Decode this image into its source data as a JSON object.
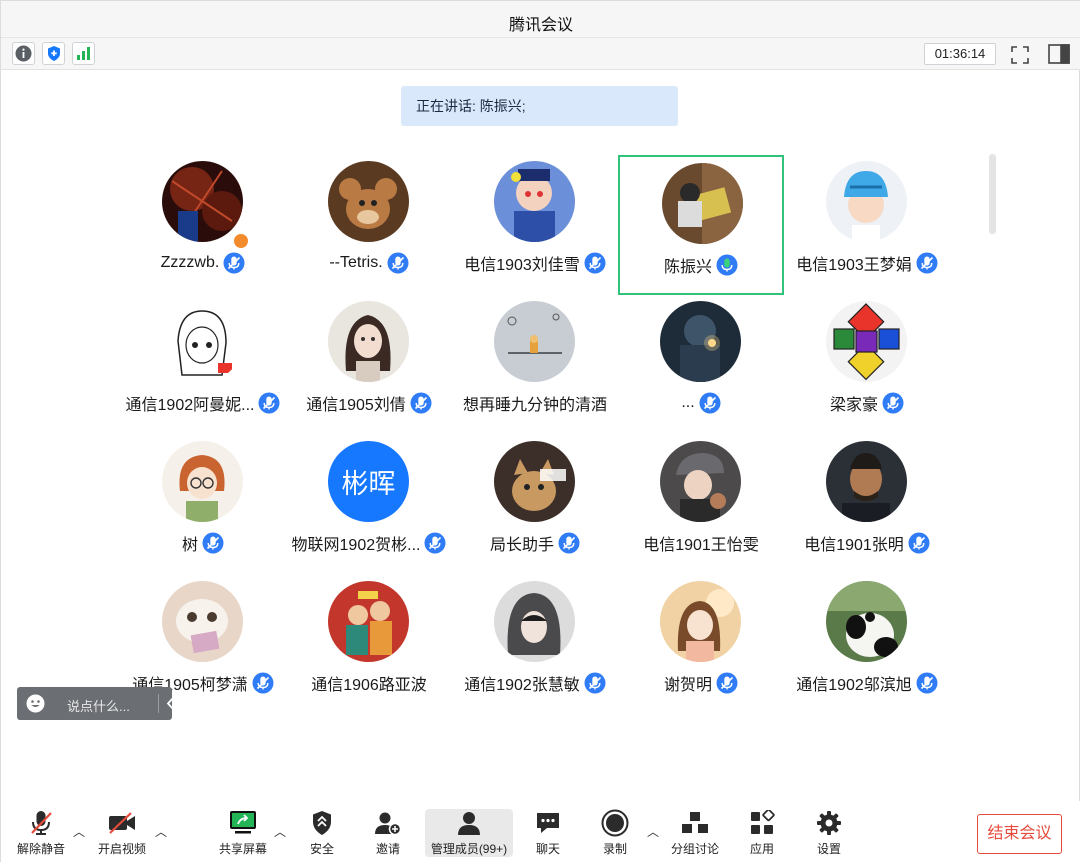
{
  "window": {
    "title": "腾讯会议"
  },
  "topbar": {
    "timer": "01:36:14",
    "icons": [
      "info-icon",
      "shield-icon",
      "signal-icon",
      "fullscreen-icon",
      "sidebar-icon"
    ]
  },
  "speaking": {
    "text": "正在讲话: 陈振兴;"
  },
  "participants": [
    {
      "name": "Zzzzwb.",
      "mic": "muted",
      "avatar": "dark-red"
    },
    {
      "name": "--Tetris.",
      "mic": "muted",
      "avatar": "cartoon-mouse"
    },
    {
      "name": "电信1903刘佳雪",
      "mic": "muted",
      "avatar": "anime-girl"
    },
    {
      "name": "陈振兴",
      "mic": "speaking",
      "avatar": "photo"
    },
    {
      "name": "电信1903王梦娟",
      "mic": "muted",
      "avatar": "helmet-boy"
    },
    {
      "name": "通信1902阿曼妮...",
      "mic": "muted",
      "avatar": "manga-girl"
    },
    {
      "name": "通信1905刘倩",
      "mic": "muted",
      "avatar": "portrait-girl"
    },
    {
      "name": "想再睡九分钟的清酒",
      "mic": "none",
      "avatar": "grey-drawing"
    },
    {
      "name": "...",
      "mic": "muted",
      "avatar": "dark-blue"
    },
    {
      "name": "梁家豪",
      "mic": "muted",
      "avatar": "geometric"
    },
    {
      "name": "树",
      "mic": "muted",
      "avatar": "glasses-girl"
    },
    {
      "name": "物联网1902贺彬...",
      "mic": "muted",
      "avatar": "text",
      "avatar_text": "彬晖"
    },
    {
      "name": "局长助手",
      "mic": "muted",
      "avatar": "cat-meme"
    },
    {
      "name": "电信1901王怡雯",
      "mic": "none",
      "avatar": "cap-girl"
    },
    {
      "name": "电信1901张明",
      "mic": "muted",
      "avatar": "player"
    },
    {
      "name": "通信1905柯梦潇",
      "mic": "muted",
      "avatar": "white-cat"
    },
    {
      "name": "通信1906路亚波",
      "mic": "none",
      "avatar": "red-art"
    },
    {
      "name": "通信1902张慧敏",
      "mic": "muted",
      "avatar": "hood-girl"
    },
    {
      "name": "谢贺明",
      "mic": "muted",
      "avatar": "anime-sunset"
    },
    {
      "name": "通信1902邬滨旭",
      "mic": "muted",
      "avatar": "panda"
    }
  ],
  "chat": {
    "placeholder": "说点什么..."
  },
  "bottombar": {
    "unmute": "解除静音",
    "video": "开启视频",
    "share": "共享屏幕",
    "security": "安全",
    "invite": "邀请",
    "members": "管理成员(99+)",
    "chat": "聊天",
    "record": "录制",
    "breakout": "分组讨论",
    "apps": "应用",
    "settings": "设置",
    "end": "结束会议"
  },
  "colors": {
    "accent": "#1677ff",
    "speaking_green": "#32c37a",
    "end_red": "#e64b3c"
  }
}
